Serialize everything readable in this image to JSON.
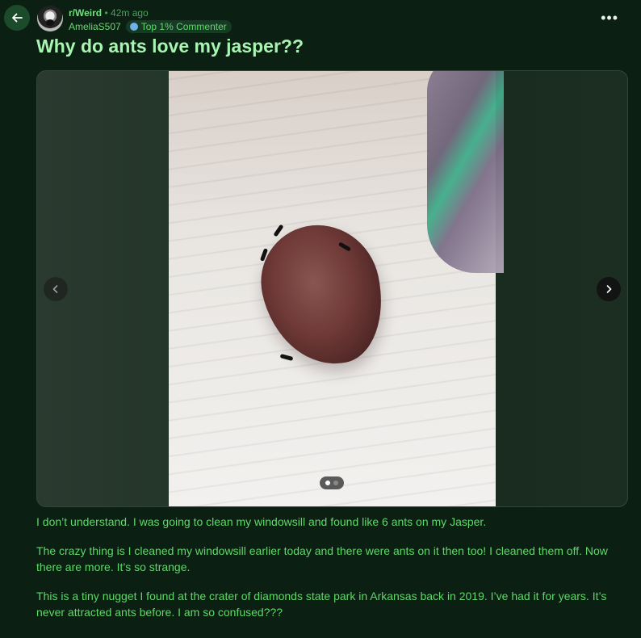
{
  "post": {
    "subreddit": "r/Weird",
    "separator": "•",
    "time": "42m ago",
    "author": "AmeliaS507",
    "badge": "Top 1% Commenter",
    "title": "Why do ants love my jasper??",
    "more_label": "•••",
    "paragraphs": [
      "I don’t understand. I was going to clean my windowsill and found like 6 ants on my Jasper.",
      "The crazy thing is I cleaned my windowsill earlier today and there were ants on it then too! I cleaned them off. Now there are more. It’s so strange.",
      "This is a tiny nugget I found at the crater of diamonds state park in Arkansas back in 2019. I’ve had it for years. It’s never attracted ants before. I am so confused???"
    ]
  },
  "gallery": {
    "current_index": 1,
    "total": 2
  },
  "icons": {
    "back": "arrow-left-icon",
    "prev": "chevron-left-icon",
    "next": "chevron-right-icon",
    "more": "more-horizontal-icon",
    "badge": "commenter-badge-icon"
  },
  "colors": {
    "background": "#0b1f12",
    "text": "#5fd86a",
    "title": "#a8f5b2",
    "badge_bg": "#173a24"
  }
}
